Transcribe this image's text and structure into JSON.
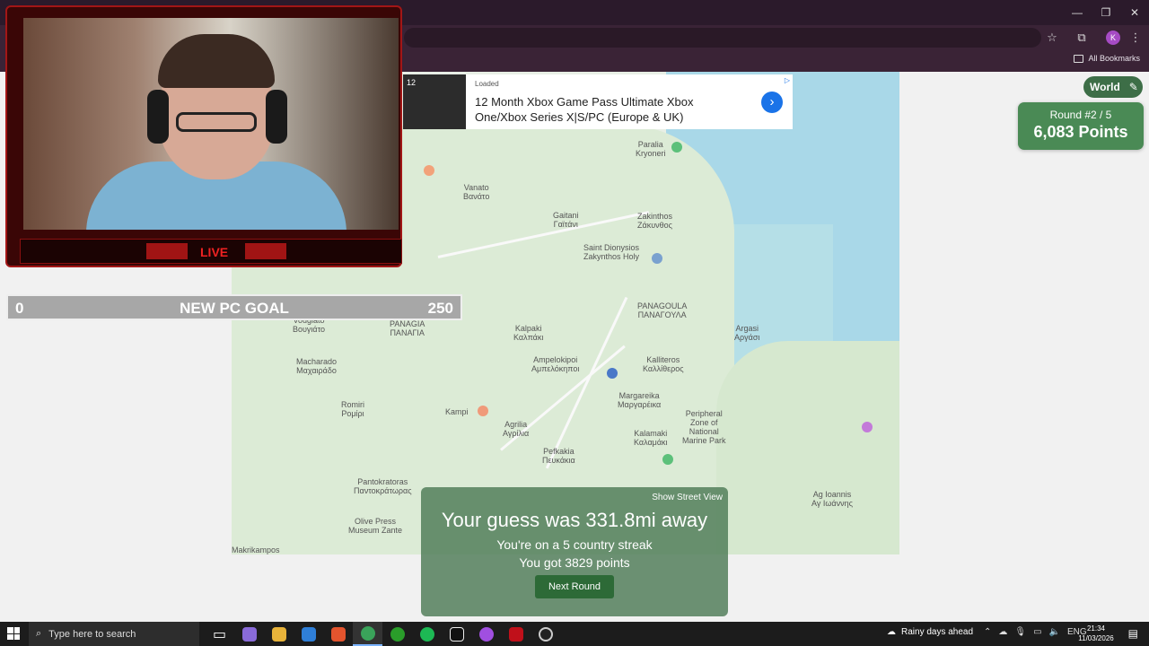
{
  "browser": {
    "window_controls": [
      "—",
      "❐",
      "✕"
    ],
    "profile_initial": "K",
    "all_bookmarks_label": "All Bookmarks"
  },
  "ad": {
    "status": "Loaded",
    "thumb_text": "12",
    "title": "12 Month Xbox Game Pass Ultimate Xbox One/Xbox Series X|S/PC (Europe & UK)",
    "arrow": "›",
    "choice": "▷"
  },
  "game": {
    "mode_label": "World",
    "round_label": "Round #2 / 5",
    "points_label": "6,083 Points",
    "result": {
      "show_street_view": "Show Street View",
      "guess_text": "Your guess was 331.8mi away",
      "streak_text": "You're on a 5 country streak",
      "points_text": "You got 3829 points",
      "next_button": "Next Round"
    }
  },
  "map": {
    "places": [
      {
        "name": "Vanato\nΒανάτο"
      },
      {
        "name": "Gaitani\nΓαϊτάνι"
      },
      {
        "name": "Zakinthos\nΖάκυνθος"
      },
      {
        "name": "Paralia\nKryoneri"
      },
      {
        "name": "Saint Dionysios\nZakynthos Holy"
      },
      {
        "name": "PANAGOULA\nΠΑΝΑΓΟΥΛΑ"
      },
      {
        "name": "Kalpaki\nΚαλπάκι"
      },
      {
        "name": "Ampelokipoi\nΑμπελόκηποι"
      },
      {
        "name": "Kalliteros\nΚαλλίθερος"
      },
      {
        "name": "Argasi\nΑργάσι"
      },
      {
        "name": "Margareika\nΜαργαρέικα"
      },
      {
        "name": "Vougiato\nΒουγιάτο"
      },
      {
        "name": "PANAGIA\nΠΑΝΑΓΙΑ"
      },
      {
        "name": "Macharado\nΜαχαιράδο"
      },
      {
        "name": "Romiri\nΡομίρι"
      },
      {
        "name": "Kampi"
      },
      {
        "name": "Agrilia\nΑγρίλια"
      },
      {
        "name": "Pefkakia\nΠευκάκια"
      },
      {
        "name": "Kalamaki\nΚαλαμάκι"
      },
      {
        "name": "Pantokratoras\nΠαντοκράτωρας"
      },
      {
        "name": "Olive Press\nMuseum Zante"
      },
      {
        "name": "Ag Ioannis\nΑγ Ιωάννης"
      },
      {
        "name": "Makrikampos"
      },
      {
        "name": "Peripheral\nZone of\nNational\nMarine Park"
      }
    ]
  },
  "stream": {
    "live_label": "LIVE",
    "goal_start": "0",
    "goal_label": "NEW PC GOAL",
    "goal_end": "250"
  },
  "taskbar": {
    "search_placeholder": "Type here to search",
    "weather_text": "Rainy days ahead",
    "language": "ENG",
    "time": "21:34",
    "date": "11/03/2026"
  }
}
